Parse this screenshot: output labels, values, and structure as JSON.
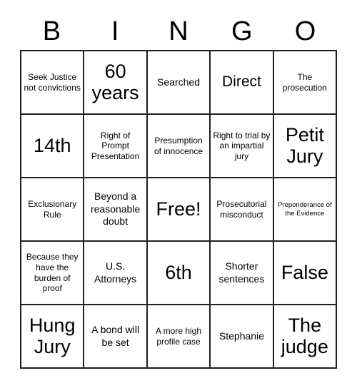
{
  "card": {
    "header_letters": [
      "B",
      "I",
      "N",
      "G",
      "O"
    ],
    "rows": [
      [
        {
          "text": "Seek Justice not convictions",
          "size": "sz-s"
        },
        {
          "text": "60 years",
          "size": "sz-xl"
        },
        {
          "text": "Searched",
          "size": "sz-m"
        },
        {
          "text": "Direct",
          "size": "sz-l"
        },
        {
          "text": "The prosecution",
          "size": "sz-s"
        }
      ],
      [
        {
          "text": "14th",
          "size": "sz-xl"
        },
        {
          "text": "Right of Prompt Presentation",
          "size": "sz-s"
        },
        {
          "text": "Presumption of innocence",
          "size": "sz-s"
        },
        {
          "text": "Right to trial by an impartial jury",
          "size": "sz-s"
        },
        {
          "text": "Petit Jury",
          "size": "sz-xl"
        }
      ],
      [
        {
          "text": "Exclusionary Rule",
          "size": "sz-s"
        },
        {
          "text": "Beyond a reasonable doubt",
          "size": "sz-m"
        },
        {
          "text": "Free!",
          "size": "sz-xl"
        },
        {
          "text": "Prosecutorial misconduct",
          "size": "sz-s"
        },
        {
          "text": "Preponderance of the Evidence",
          "size": "sz-xs"
        }
      ],
      [
        {
          "text": "Because they have the burden of proof",
          "size": "sz-s"
        },
        {
          "text": "U.S. Attorneys",
          "size": "sz-m"
        },
        {
          "text": "6th",
          "size": "sz-xl"
        },
        {
          "text": "Shorter sentences",
          "size": "sz-m"
        },
        {
          "text": "False",
          "size": "sz-xl"
        }
      ],
      [
        {
          "text": "Hung Jury",
          "size": "sz-xl"
        },
        {
          "text": "A bond will be set",
          "size": "sz-m"
        },
        {
          "text": "A more high profile case",
          "size": "sz-s"
        },
        {
          "text": "Stephanie",
          "size": "sz-m"
        },
        {
          "text": "The judge",
          "size": "sz-xl"
        }
      ]
    ]
  },
  "colors": {
    "border": "#202020",
    "text": "#000000",
    "background": "#ffffff"
  }
}
